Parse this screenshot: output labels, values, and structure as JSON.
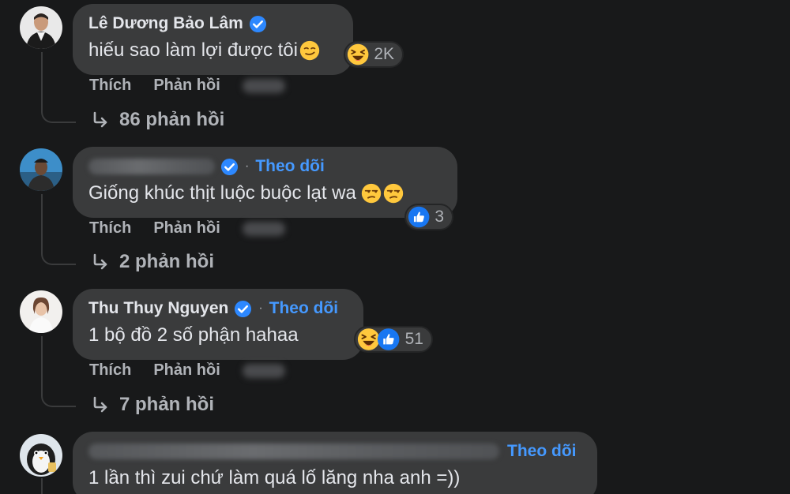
{
  "comments": [
    {
      "author": "Lê Dương Bảo Lâm",
      "verified": true,
      "text": "hiếu sao làm lợi được tôi",
      "inline_emoji": [
        "smirk-emoji"
      ],
      "reactions": {
        "emojis": [
          "laughing-emoji"
        ],
        "count": "2K"
      },
      "actions": {
        "like": "Thích",
        "reply": "Phản hồi"
      },
      "replies": "86 phản hồi"
    },
    {
      "author": "",
      "verified": true,
      "follow": "Theo dõi",
      "text": "Giống khúc thịt luộc buộc lạt wa",
      "inline_emoji": [
        "unamused-emoji",
        "unamused-emoji"
      ],
      "reactions": {
        "emojis": [
          "like-emoji"
        ],
        "count": "3"
      },
      "actions": {
        "like": "Thích",
        "reply": "Phản hồi"
      },
      "replies": "2 phản hồi"
    },
    {
      "author": "Thu Thuy Nguyen",
      "verified": true,
      "follow": "Theo dõi",
      "text": "1 bộ đồ 2 số phận hahaa",
      "reactions": {
        "emojis": [
          "laughing-emoji",
          "like-emoji"
        ],
        "count": "51"
      },
      "actions": {
        "like": "Thích",
        "reply": "Phản hồi"
      },
      "replies": "7 phản hồi"
    },
    {
      "author": "",
      "verified": false,
      "follow": "Theo dõi",
      "text": "1 lần thì zui chứ làm quá lố lăng nha anh =))"
    }
  ],
  "colors": {
    "background": "#18191a",
    "bubble": "#3a3b3c",
    "primary_text": "#e4e6eb",
    "secondary_text": "#b0b3b8",
    "link_blue": "#4599ff",
    "verified_blue": "#2d88ff"
  }
}
